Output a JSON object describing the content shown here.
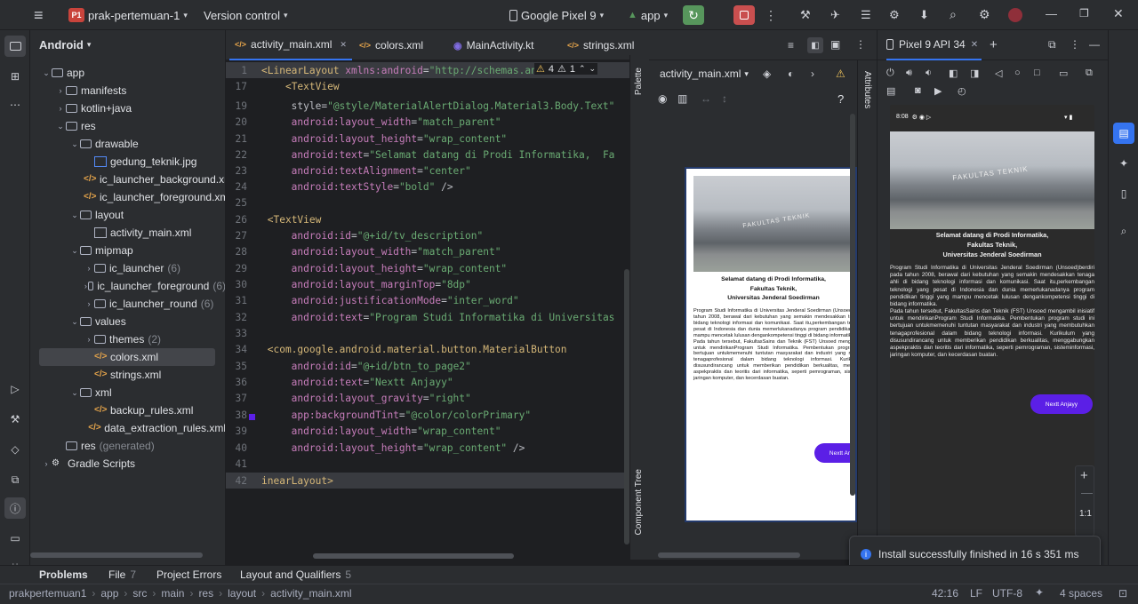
{
  "titlebar": {
    "project_badge": "P1",
    "project_name": "prak-pertemuan-1",
    "version_control": "Version control",
    "device": "Google Pixel 9",
    "run_config": "app"
  },
  "project_panel": {
    "view": "Android",
    "tree": [
      {
        "label": "app",
        "depth": 0,
        "kind": "module",
        "expanded": true
      },
      {
        "label": "manifests",
        "depth": 1,
        "kind": "folder",
        "expanded": false
      },
      {
        "label": "kotlin+java",
        "depth": 1,
        "kind": "folder",
        "expanded": false
      },
      {
        "label": "res",
        "depth": 1,
        "kind": "folder",
        "expanded": true
      },
      {
        "label": "drawable",
        "depth": 2,
        "kind": "folder",
        "expanded": true
      },
      {
        "label": "gedung_teknik.jpg",
        "depth": 3,
        "kind": "image"
      },
      {
        "label": "ic_launcher_background.xml",
        "depth": 3,
        "kind": "xml"
      },
      {
        "label": "ic_launcher_foreground.xml",
        "depth": 3,
        "kind": "xml"
      },
      {
        "label": "layout",
        "depth": 2,
        "kind": "folder",
        "expanded": true
      },
      {
        "label": "activity_main.xml",
        "depth": 3,
        "kind": "layout"
      },
      {
        "label": "mipmap",
        "depth": 2,
        "kind": "folder",
        "expanded": true
      },
      {
        "label": "ic_launcher",
        "depth": 3,
        "kind": "folder",
        "count": "(6)",
        "expanded": false
      },
      {
        "label": "ic_launcher_foreground",
        "depth": 3,
        "kind": "folder",
        "count": "(6)",
        "expanded": false
      },
      {
        "label": "ic_launcher_round",
        "depth": 3,
        "kind": "folder",
        "count": "(6)",
        "expanded": false
      },
      {
        "label": "values",
        "depth": 2,
        "kind": "folder",
        "expanded": true
      },
      {
        "label": "themes",
        "depth": 3,
        "kind": "folder",
        "count": "(2)",
        "expanded": false
      },
      {
        "label": "colors.xml",
        "depth": 3,
        "kind": "xml",
        "selected": true
      },
      {
        "label": "strings.xml",
        "depth": 3,
        "kind": "xml"
      },
      {
        "label": "xml",
        "depth": 2,
        "kind": "folder",
        "expanded": true
      },
      {
        "label": "backup_rules.xml",
        "depth": 3,
        "kind": "xml"
      },
      {
        "label": "data_extraction_rules.xml",
        "depth": 3,
        "kind": "xml"
      },
      {
        "label": "res",
        "depth": 1,
        "kind": "folder",
        "count": "(generated)"
      },
      {
        "label": "Gradle Scripts",
        "depth": 0,
        "kind": "gradle",
        "expanded": false
      }
    ]
  },
  "editor_tabs": [
    {
      "label": "activity_main.xml",
      "active": true
    },
    {
      "label": "colors.xml",
      "active": false
    },
    {
      "label": "MainActivity.kt",
      "active": false
    },
    {
      "label": "strings.xml",
      "active": false
    }
  ],
  "inspection": {
    "warnings": "4",
    "weak": "1"
  },
  "code_lines": [
    {
      "n": "1",
      "parts": [
        [
          "tag",
          "<LinearLayout "
        ],
        [
          "ns",
          "xmlns:android"
        ],
        [
          "plain",
          "="
        ],
        [
          "str",
          "\"http://schemas.an"
        ]
      ]
    },
    {
      "n": "17",
      "parts": [
        [
          "plain",
          "    "
        ],
        [
          "tag",
          "<TextView"
        ]
      ]
    },
    {
      "n": "19",
      "parts": [
        [
          "plain",
          "     style="
        ],
        [
          "str",
          "\"@style/MaterialAlertDialog.Material3.Body.Text\""
        ]
      ]
    },
    {
      "n": "20",
      "parts": [
        [
          "attr",
          "     android:layout_width"
        ],
        [
          "plain",
          "="
        ],
        [
          "str",
          "\"match_parent\""
        ]
      ]
    },
    {
      "n": "21",
      "parts": [
        [
          "attr",
          "     android:layout_height"
        ],
        [
          "plain",
          "="
        ],
        [
          "str",
          "\"wrap_content\""
        ]
      ]
    },
    {
      "n": "22",
      "parts": [
        [
          "attr",
          "     android:text"
        ],
        [
          "plain",
          "="
        ],
        [
          "str",
          "\"Selamat datang di Prodi Informatika,  Fa"
        ]
      ]
    },
    {
      "n": "23",
      "parts": [
        [
          "attr",
          "     android:textAlignment"
        ],
        [
          "plain",
          "="
        ],
        [
          "str",
          "\"center\""
        ]
      ]
    },
    {
      "n": "24",
      "parts": [
        [
          "attr",
          "     android:textStyle"
        ],
        [
          "plain",
          "="
        ],
        [
          "str",
          "\"bold\""
        ],
        [
          "plain",
          " />"
        ]
      ]
    },
    {
      "n": "25",
      "parts": []
    },
    {
      "n": "26",
      "parts": [
        [
          "plain",
          " "
        ],
        [
          "tag",
          "<TextView"
        ]
      ]
    },
    {
      "n": "27",
      "parts": [
        [
          "attr",
          "     android:id"
        ],
        [
          "plain",
          "="
        ],
        [
          "str",
          "\"@+id/tv_description\""
        ]
      ]
    },
    {
      "n": "28",
      "parts": [
        [
          "attr",
          "     android:layout_width"
        ],
        [
          "plain",
          "="
        ],
        [
          "str",
          "\"match_parent\""
        ]
      ]
    },
    {
      "n": "29",
      "parts": [
        [
          "attr",
          "     android:layout_height"
        ],
        [
          "plain",
          "="
        ],
        [
          "str",
          "\"wrap_content\""
        ]
      ]
    },
    {
      "n": "30",
      "parts": [
        [
          "attr",
          "     android:layout_marginTop"
        ],
        [
          "plain",
          "="
        ],
        [
          "str",
          "\"8dp\""
        ]
      ]
    },
    {
      "n": "31",
      "parts": [
        [
          "attr",
          "     android:justificationMode"
        ],
        [
          "plain",
          "="
        ],
        [
          "str",
          "\"inter_word\""
        ]
      ]
    },
    {
      "n": "32",
      "parts": [
        [
          "attr",
          "     android:text"
        ],
        [
          "plain",
          "="
        ],
        [
          "str",
          "\"Program Studi Informatika di Universitas"
        ]
      ]
    },
    {
      "n": "33",
      "parts": []
    },
    {
      "n": "34",
      "parts": [
        [
          "plain",
          " "
        ],
        [
          "tag",
          "<com.google.android.material.button.MaterialButton"
        ]
      ]
    },
    {
      "n": "35",
      "parts": [
        [
          "attr",
          "     android:id"
        ],
        [
          "plain",
          "="
        ],
        [
          "str",
          "\"@+id/btn_to_page2\""
        ]
      ]
    },
    {
      "n": "36",
      "parts": [
        [
          "attr",
          "     android:text"
        ],
        [
          "plain",
          "="
        ],
        [
          "str",
          "\"Nextt Anjayy\""
        ]
      ]
    },
    {
      "n": "37",
      "parts": [
        [
          "attr",
          "     android:layout_gravity"
        ],
        [
          "plain",
          "="
        ],
        [
          "str",
          "\"right\""
        ]
      ]
    },
    {
      "n": "38",
      "parts": [
        [
          "attr",
          "     app:backgroundTint"
        ],
        [
          "plain",
          "="
        ],
        [
          "str",
          "\"@color/colorPrimary\""
        ]
      ]
    },
    {
      "n": "39",
      "parts": [
        [
          "attr",
          "     android:layout_width"
        ],
        [
          "plain",
          "="
        ],
        [
          "str",
          "\"wrap_content\""
        ]
      ]
    },
    {
      "n": "40",
      "parts": [
        [
          "attr",
          "     android:layout_height"
        ],
        [
          "plain",
          "="
        ],
        [
          "str",
          "\"wrap_content\""
        ],
        [
          "plain",
          " />"
        ]
      ]
    },
    {
      "n": "41",
      "parts": []
    },
    {
      "n": "42",
      "parts": [
        [
          "tag",
          "inearLayout>"
        ]
      ]
    }
  ],
  "designer": {
    "file_select": "activity_main.xml",
    "palette_label": "Palette",
    "component_tree_label": "Component Tree",
    "attributes_label": "Attributes",
    "help": "?"
  },
  "app_preview": {
    "welcome_line1": "Selamat datang di Prodi Informatika,",
    "welcome_line2": "Fakultas Teknik,",
    "welcome_line3": "Universitas Jenderal Soedirman",
    "description": "Program Studi Informatika di Universitas Jenderal Soedirman (Unsoed)berdiri pada tahun 2008, berawal dari kebutuhan yang semakin mendesakkan tenaga ahli di bidang teknologi informasi dan komunikasi. Saat itu,perkembangan teknologi yang pesat di Indonesia dan dunia memerlukanadanya program pendidikan tinggi yang mampu mencetak lulusan dengankompetensi tinggi di bidang informatika.",
    "description2": "Pada tahun tersebut, FakultasSains dan Teknik (FST) Unsoed mengambil inisiatif untuk mendirikanProgram Studi Informatika. Pembentukan program studi ini bertujuan untukmemenuhi tuntutan masyarakat dan industri yang membutuhkan tenagaprofesional dalam bidang teknologi informasi. Kurikulum yang disusundirancang untuk memberikan pendidikan berkualitas, menggabungkan aspekpraktis dan teoritis dari informatika, seperti pemrograman, sisteminformasi, jaringan komputer, dan kecerdasan buatan.",
    "button": "Nextt Anjayy",
    "building_sign": "FAKULTAS TEKNIK"
  },
  "emulator": {
    "tab_title": "Pixel 9 API 34",
    "time": "8:08",
    "zoom_ratio": "1:1"
  },
  "toast": {
    "message": "Install successfully finished in 16 s 351 ms"
  },
  "bottom_tabs": [
    {
      "label": "Problems",
      "count": ""
    },
    {
      "label": "File",
      "count": "7"
    },
    {
      "label": "Project Errors",
      "count": ""
    },
    {
      "label": "Layout and Qualifiers",
      "count": "5"
    }
  ],
  "statusbar": {
    "breadcrumb": [
      "prakpertemuan1",
      "app",
      "src",
      "main",
      "res",
      "layout",
      "activity_main.xml"
    ],
    "position": "42:16",
    "line_sep": "LF",
    "encoding": "UTF-8",
    "indent": "4 spaces"
  },
  "colors": {
    "accent": "#3574f0",
    "button": "#5b1fe6",
    "run_green": "#57965c",
    "stop_red": "#c94f4f"
  }
}
